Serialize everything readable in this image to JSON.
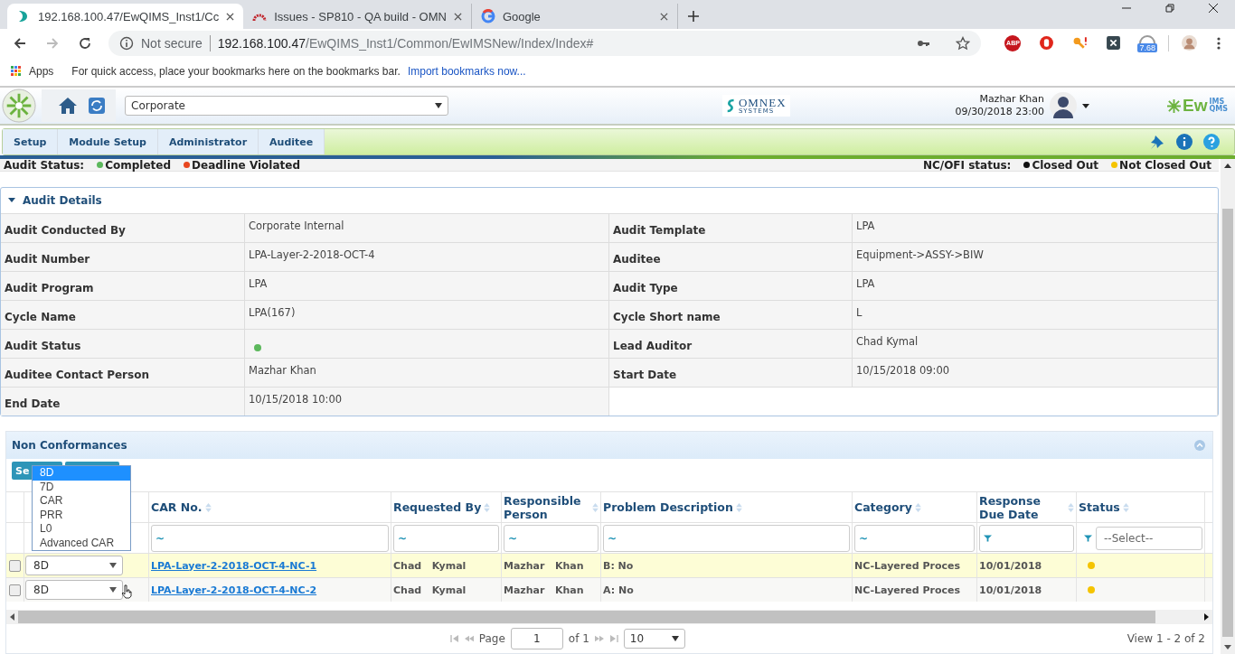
{
  "browser": {
    "tabs": [
      {
        "title": "192.168.100.47/EwQIMS_Inst1/Cc",
        "selected": true
      },
      {
        "title": "Issues - SP810 - QA build - OMN",
        "selected": false
      },
      {
        "title": "Google",
        "selected": false
      }
    ],
    "address": {
      "security": "Not secure",
      "host": "192.168.100.47",
      "path": "/EwQIMS_Inst1/Common/EwIMSNew/Index/Index#"
    },
    "extensions": {
      "abp": "ABP",
      "speed_badge": "7.68"
    },
    "bookmarks": {
      "apps": "Apps",
      "hint": "For quick access, place your bookmarks here on the bookmarks bar.",
      "import_link": "Import bookmarks now..."
    }
  },
  "header": {
    "site": "Corporate",
    "company_logo": {
      "name": "OMNEX",
      "tagline": "SYSTEMS"
    },
    "user": "Mazhar Khan",
    "datetime": "09/30/2018 23:00",
    "brand": {
      "main": "Ew",
      "top": "IMS",
      "bottom": "QMS"
    }
  },
  "menu": [
    {
      "label": "Setup",
      "selected": false
    },
    {
      "label": "Module Setup",
      "selected": false
    },
    {
      "label": "Administrator",
      "selected": false
    },
    {
      "label": "Auditee",
      "selected": false
    }
  ],
  "legend": {
    "audit_label": "Audit Status:",
    "audit_items": [
      {
        "label": "Completed",
        "color": "#5cb85c"
      },
      {
        "label": "Deadline Violated",
        "color": "#e8461e"
      }
    ],
    "nc_label": "NC/OFI status:",
    "nc_items": [
      {
        "label": "Closed Out",
        "color": "#111111"
      },
      {
        "label": "Not Closed Out",
        "color": "#f5c400"
      }
    ]
  },
  "audit_details": {
    "title": "Audit Details",
    "expanded": true,
    "fields": [
      {
        "label": "Audit Conducted By",
        "kind": "text",
        "value": "Corporate Internal"
      },
      {
        "label": "Audit Template",
        "kind": "text",
        "value": "LPA"
      },
      {
        "label": "Audit Number",
        "kind": "text",
        "value": "LPA-Layer-2-2018-OCT-4"
      },
      {
        "label": "Auditee",
        "kind": "text",
        "value": "Equipment->ASSY->BIW"
      },
      {
        "label": "Audit Program",
        "kind": "text",
        "value": "LPA"
      },
      {
        "label": "Audit Type",
        "kind": "text",
        "value": "LPA"
      },
      {
        "label": "Cycle Name",
        "kind": "text",
        "value": "LPA(167)"
      },
      {
        "label": "Cycle Short name",
        "kind": "text",
        "value": "L"
      },
      {
        "label": "Audit Status",
        "kind": "dot",
        "color": "#5cb85c"
      },
      {
        "label": "Lead Auditor",
        "kind": "text",
        "value": "Chad Kymal"
      },
      {
        "label": "Auditee Contact Person",
        "kind": "text",
        "value": "Mazhar Khan"
      },
      {
        "label": "Start Date",
        "kind": "text",
        "value": "10/15/2018 09:00"
      },
      {
        "label": "End Date",
        "kind": "text",
        "value": "10/15/2018 10:00"
      }
    ]
  },
  "non_conformances": {
    "title": "Non Conformances",
    "button": "Se",
    "type_options": [
      {
        "label": "8D",
        "selected": true
      },
      {
        "label": "7D",
        "selected": false
      },
      {
        "label": "CAR",
        "selected": false
      },
      {
        "label": "PRR",
        "selected": false
      },
      {
        "label": "L0",
        "selected": false
      },
      {
        "label": "Advanced CAR",
        "selected": false
      }
    ],
    "columns": [
      {
        "label": "CAR No.",
        "kind": "text"
      },
      {
        "label": "Requested By",
        "kind": "text"
      },
      {
        "label": "Responsible Person",
        "kind": "text"
      },
      {
        "label": "Problem Description",
        "kind": "text"
      },
      {
        "label": "Category",
        "kind": "text"
      },
      {
        "label": "Response Due Date",
        "kind": "date"
      },
      {
        "label": "Status",
        "kind": "select"
      }
    ],
    "filter_mark": "~",
    "status_placeholder": "--Select--",
    "rows": [
      {
        "selected": true,
        "checked": false,
        "type": "8D",
        "car_no": "LPA-Layer-2-2018-OCT-4-NC-1",
        "requested_by": "Chad   Kymal",
        "responsible": "Mazhar   Khan",
        "problem": "B: No",
        "category": "NC-Layered Proces",
        "due": "10/01/2018",
        "color": "#f5c400"
      },
      {
        "selected": false,
        "checked": false,
        "type": "8D",
        "car_no": "LPA-Layer-2-2018-OCT-4-NC-2",
        "requested_by": "Chad   Kymal",
        "responsible": "Mazhar   Khan",
        "problem": "A: No",
        "category": "NC-Layered Proces",
        "due": "10/01/2018",
        "color": "#f5c400"
      }
    ],
    "pager": {
      "page_label": "Page",
      "page": "1",
      "of": "of 1",
      "page_size": "10",
      "summary": "View 1 - 2 of 2"
    }
  }
}
